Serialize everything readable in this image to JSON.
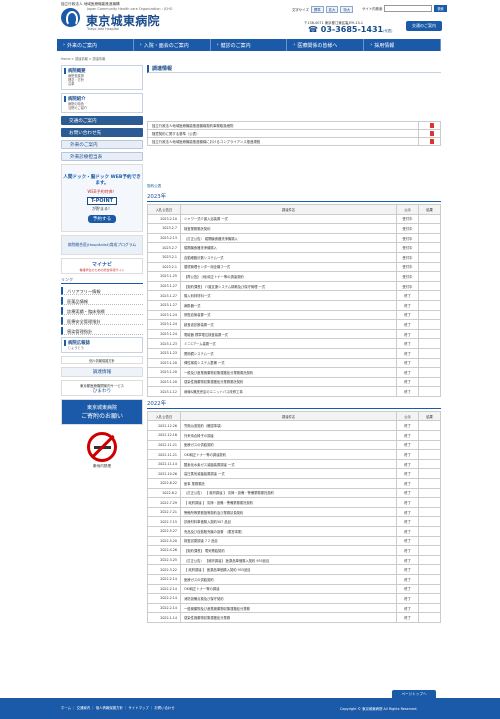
{
  "header": {
    "org_line1": "独立行政法人 地域医療機能推進機構",
    "org_line2": "Japan Community Health care Organization : JCHO",
    "title": "東京城東病院",
    "subtitle": "Tokyo Joto Hospital",
    "textsize_label": "文字サイズ",
    "sizes": [
      "標準",
      "拡大",
      "特大"
    ],
    "search_label": "サイト内検索",
    "search_button": "検索",
    "address": "〒136-0071 東京都江東区亀戸9-13-1",
    "tel": "03-3685-1431",
    "tel_note": "(代表)",
    "access": "交通のご案内"
  },
  "gnav": [
    "外来のご案内",
    "入院・面会のご案内",
    "健診のご案内",
    "医療関係の皆様へ",
    "採用情報"
  ],
  "breadcrumb": "Home > 調達情報 > 調達情報",
  "sidebar": {
    "box1_title": "病院概要",
    "box1_items": [
      "病院長挨拶",
      "理念・方針",
      "沿革"
    ],
    "box2_title": "病院紹介",
    "box2_items": [
      "病院の特色",
      "当院のご紹介"
    ],
    "buttons": [
      "交通のご案内",
      "お問い合わせ先",
      "外来のご案内",
      "外来診療担当表"
    ],
    "dock_banner": "人間ドック・脳ドック WEB予約できます。",
    "dock_sub": "WEB予約特典！",
    "tpoint": "T-POINT",
    "tpoint_sub": "が貯まる！",
    "reserve": "予約する",
    "hospitalist": "病院総合医(Hospitalist)育成プログラム",
    "mynavi": "マイナビ",
    "mynavi_sub": "看護学生のための総合情報サイト",
    "links_title": "リンク",
    "links": [
      "バリアフリー情報",
      "医薬品情報",
      "診療実績・臨床指標",
      "医療安全管理指針",
      "感染管理指針"
    ],
    "pr_title": "病院広報誌",
    "pr_name": "じょうとう",
    "info_label": "個人情報保護方針",
    "procurement": "調達情報",
    "welfare": "東京都医療機関案内サービス",
    "welfare_name": "ひまわり",
    "request_title": "東京城東病院",
    "request_sub": "ご寄附のお願い",
    "nosmoke": "敷地内禁煙"
  },
  "main": {
    "title": "調達情報",
    "top_rows": [
      "独立行政法人地域医療機能推進機構契約事務取扱細則",
      "随意契約に関する基準（公表）",
      "独立行政法人地域医療機能推進機構におけるコンプライアンス推進規程"
    ],
    "result_link": "契約公表",
    "year2023": "2023年",
    "year2022": "2022年",
    "headers": [
      "入札公告日",
      "調達件名",
      "公示",
      "結果"
    ],
    "rows2023": [
      [
        "2023.2.10",
        "シャワー式介護入浴装置 一式",
        "受付中",
        ""
      ],
      [
        "2023.2.7",
        "検査業務委託契約",
        "受付中",
        ""
      ],
      [
        "2023.2.13",
        "（訂正公告） 縦隔膜食器洗浄機購入",
        "受付中",
        ""
      ],
      [
        "2023.2.7",
        "縦隔膜食器洗浄機購入",
        "受付中",
        ""
      ],
      [
        "2023.2.1",
        "自動細胞計数システム一式",
        "受付中",
        ""
      ],
      [
        "2023.2.1",
        "循環管理センター用全機フ一式",
        "受付中",
        ""
      ],
      [
        "2023.1.25",
        "【再公告】 (地)純正トナー等の調達契約",
        "受付中",
        ""
      ],
      [
        "2023.1.27",
        "【契約課長】 介護支援システム構築及び保守管理 一式",
        "受付中",
        ""
      ],
      [
        "2023.1.27",
        "購入利林材料一式",
        "終了",
        ""
      ],
      [
        "2023.1.27",
        "麻酔器一式",
        "終了",
        ""
      ],
      [
        "2023.1.24",
        "修復血管装置一式",
        "終了",
        ""
      ],
      [
        "2023.1.24",
        "超音波診断装置一式",
        "終了",
        ""
      ],
      [
        "2023.1.24",
        "電磁器 標準電位検査装置一式",
        "終了",
        ""
      ],
      [
        "2023.1.23",
        "ミニCアーム装置一式",
        "終了",
        ""
      ],
      [
        "2023.1.23",
        "関節鏡システム一式",
        "終了",
        ""
      ],
      [
        "2023.1.20",
        "弾性構成システム整備 一式",
        "終了",
        ""
      ],
      [
        "2023.1.20",
        "一般及び産業廃棄物収集運搬処分業務委託契約",
        "終了",
        ""
      ],
      [
        "2023.1.20",
        "感染性廃棄物収集運搬処分業務委託契約",
        "終了",
        ""
      ],
      [
        "2023.1.12",
        "病棟&徹底売店のユニットバス改修工事",
        "終了",
        ""
      ]
    ],
    "rows2022": [
      [
        "2022.12.26",
        "労働派遣契約（確認事項）",
        "終了",
        ""
      ],
      [
        "2022.12.16",
        "外来待合椅子の調達",
        "終了",
        ""
      ],
      [
        "2022.11.21",
        "医療ガスの供給契約",
        "終了",
        ""
      ],
      [
        "2022.11.21",
        "OKI純正トナー等の調達契約",
        "終了",
        ""
      ],
      [
        "2022.11.14",
        "酸素化水素ガス滅菌装置調達 一式",
        "終了",
        ""
      ],
      [
        "2022.10.26",
        "高圧蒸気滅菌装置調達 一式",
        "終了",
        ""
      ],
      [
        "2022.8.22",
        "医事 業務委託",
        "終了",
        ""
      ],
      [
        "2022.8.2",
        "（訂正公告） 【 政府調達 】 清掃・設備・警備業務委託契約",
        "終了",
        ""
      ],
      [
        "2022.7.29",
        "【 政府調達 】 清掃・設備・警備業務委託契約",
        "終了",
        ""
      ],
      [
        "2022.7.21",
        "警備所等業務指等契約及び業務請負契約",
        "終了",
        ""
      ],
      [
        "2022.7.15",
        "診療材料単価購入契約507 品目",
        "終了",
        ""
      ],
      [
        "2022.5.27",
        "売品及び自動販売機の設置 （運営事業）",
        "終了",
        ""
      ],
      [
        "2022.5.20",
        "検査試薬調達 7 2 品目",
        "終了",
        ""
      ],
      [
        "2022.4.26",
        "【契約課長】 電気需給契約",
        "終了",
        ""
      ],
      [
        "2022.3.25",
        "（訂正公告） 【政府調達】 医薬品単価購入契約 955品目",
        "終了",
        ""
      ],
      [
        "2022.3.22",
        "【 政府調達 】 医薬品単価購入契約 955品目",
        "終了",
        ""
      ],
      [
        "2022.2.14",
        "医療ガスの供給契約",
        "終了",
        ""
      ],
      [
        "2022.2.14",
        "OKI純正トナー等の調達",
        "終了",
        ""
      ],
      [
        "2022.2.14",
        "消防設備点検及び保守契約",
        "終了",
        ""
      ],
      [
        "2022.2.14",
        "一般廃棄物及び産業廃棄物収集運搬処分業務",
        "終了",
        ""
      ],
      [
        "2022.1.14",
        "感染性廃棄物収集運搬処分業務",
        "終了",
        ""
      ]
    ]
  },
  "pagetop": "ページトップへ",
  "footer": {
    "nav": "ホーム ｜ 交通案内 ｜ 個人情報保護方針 ｜ サイトマップ ｜ お問い合わせ",
    "copyright": "Copyright © 東京城東病院 All Rights Reserved."
  }
}
